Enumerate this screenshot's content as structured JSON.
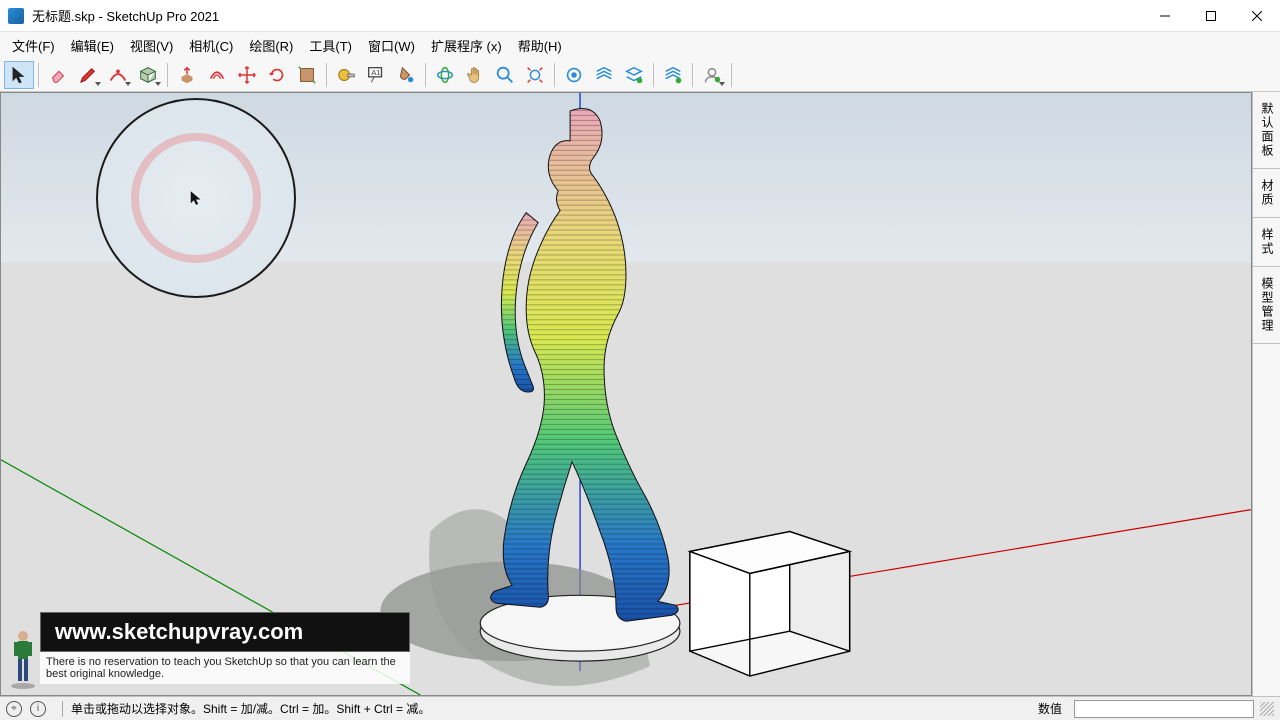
{
  "window": {
    "title": "无标题.skp - SketchUp Pro 2021"
  },
  "menu": {
    "file": "文件(F)",
    "edit": "编辑(E)",
    "view": "视图(V)",
    "camera": "相机(C)",
    "draw": "绘图(R)",
    "tools": "工具(T)",
    "window": "窗口(W)",
    "ext": "扩展程序 (x)",
    "help": "帮助(H)"
  },
  "right_tabs": {
    "default": "默认面板",
    "material": "材质",
    "style": "样式",
    "model_manage": "模型管理"
  },
  "status": {
    "hint": "单击或拖动以选择对象。Shift = 加/减。Ctrl = 加。Shift + Ctrl = 减。",
    "value_label": "数值"
  },
  "watermark": {
    "url": "www.sketchupvray.com",
    "sub": "There is no reservation to teach you SketchUp so that you can learn the best original knowledge."
  },
  "icons": {
    "select": "select",
    "eraser": "eraser",
    "pencil": "pencil",
    "arc": "arc",
    "rect": "rect",
    "pushpull": "pushpull",
    "offset": "offset",
    "move": "move",
    "rotate": "rotate",
    "scale": "scale",
    "tape": "tape",
    "text": "text",
    "paint": "paint",
    "orbit": "orbit",
    "pan": "pan",
    "zoom": "zoom",
    "zoom_ext": "zoom_ext"
  }
}
